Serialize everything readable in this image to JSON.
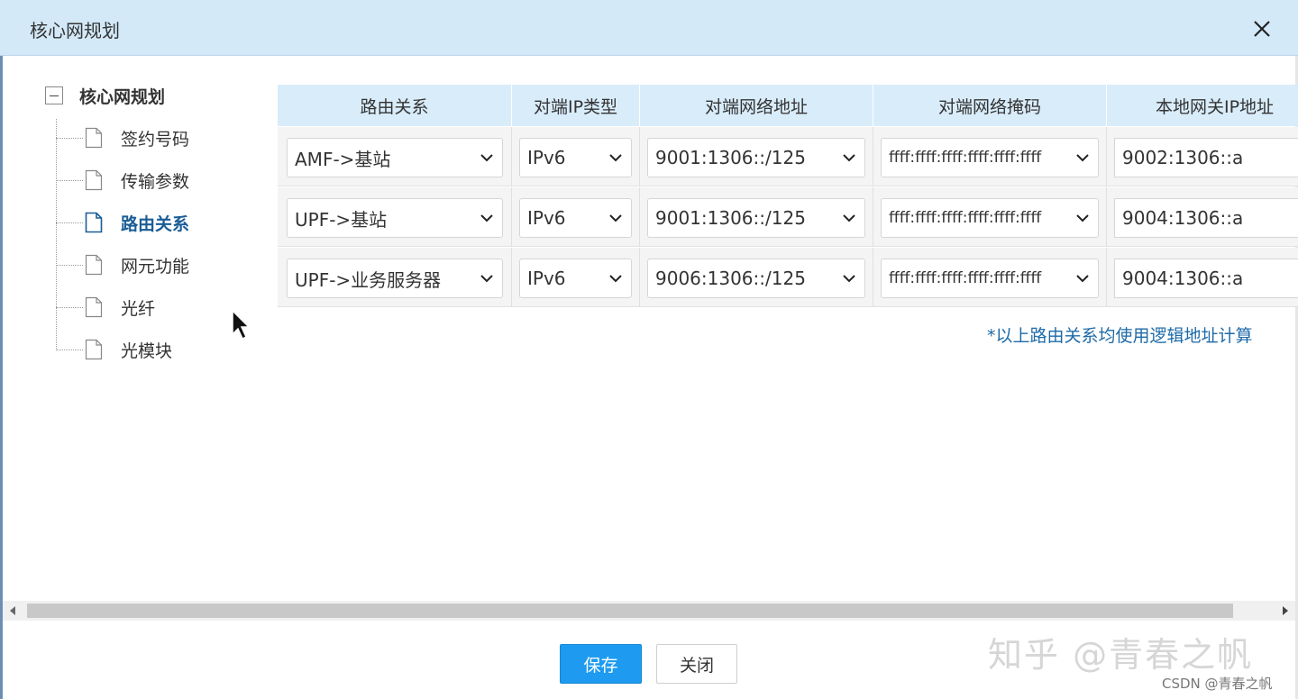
{
  "dialog": {
    "title": "核心网规划"
  },
  "tree": {
    "root": "核心网规划",
    "items": [
      "签约号码",
      "传输参数",
      "路由关系",
      "网元功能",
      "光纤",
      "光模块"
    ],
    "active": "路由关系"
  },
  "table": {
    "headers": [
      "路由关系",
      "对端IP类型",
      "对端网络地址",
      "对端网络掩码",
      "本地网关IP地址"
    ],
    "rows": [
      {
        "route": "AMF->基站",
        "ip_type": "IPv6",
        "net_addr": "9001:1306::/125",
        "mask": "ffff:ffff:ffff:ffff:ffff:ffff",
        "gateway": "9002:1306::a"
      },
      {
        "route": "UPF->基站",
        "ip_type": "IPv6",
        "net_addr": "9001:1306::/125",
        "mask": "ffff:ffff:ffff:ffff:ffff:ffff",
        "gateway": "9004:1306::a"
      },
      {
        "route": "UPF->业务服务器",
        "ip_type": "IPv6",
        "net_addr": "9006:1306::/125",
        "mask": "ffff:ffff:ffff:ffff:ffff:ffff",
        "gateway": "9004:1306::a"
      }
    ]
  },
  "note": "*以上路由关系均使用逻辑地址计算",
  "buttons": {
    "save": "保存",
    "close": "关闭"
  },
  "watermark": {
    "main": "知乎 @青春之帆",
    "small": "CSDN @青春之帆"
  },
  "colors": {
    "titlebar": "#d3e9f8",
    "header": "#d9ecfa",
    "primary": "#1e9bf0",
    "link": "#1d6aa8"
  }
}
